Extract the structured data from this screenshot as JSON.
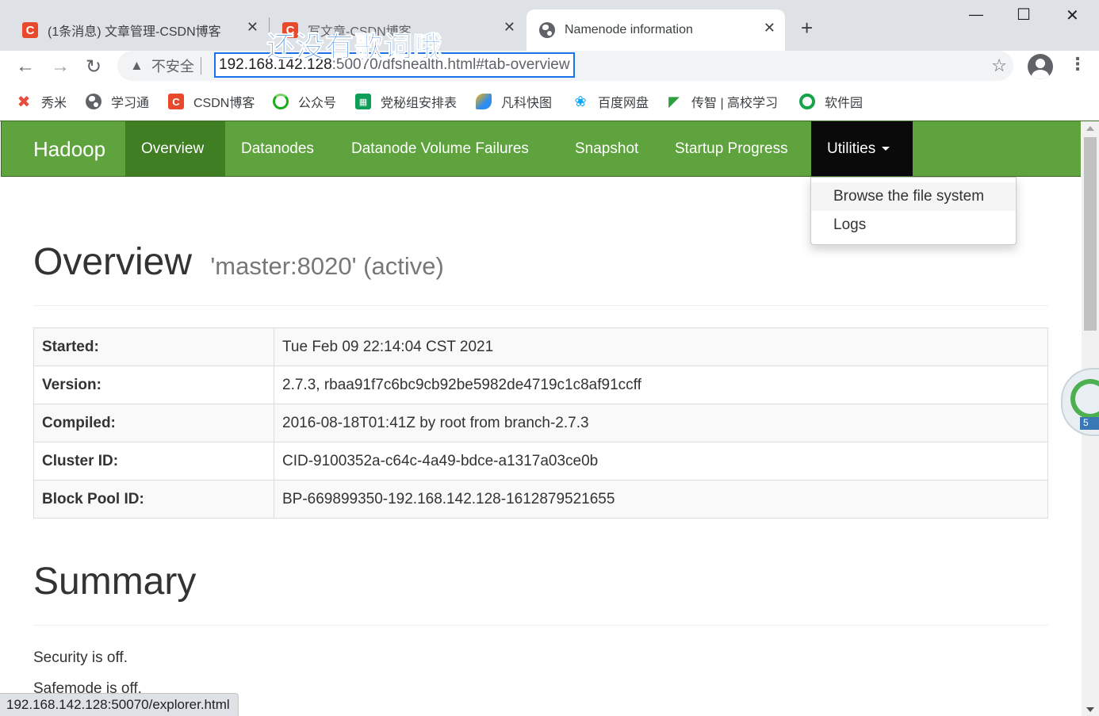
{
  "browser": {
    "tabs": [
      {
        "title": "(1条消息) 文章管理-CSDN博客",
        "icon": "csdn-icon",
        "active": false
      },
      {
        "title": "写文章-CSDN博客",
        "icon": "csdn-icon",
        "active": false
      },
      {
        "title": "Namenode information",
        "icon": "globe-icon",
        "active": true
      }
    ],
    "favicon_letter": "C",
    "new_tab": "+",
    "window_controls": {
      "minimize": "—",
      "maximize": "☐",
      "close": "✕"
    },
    "overlay_text": "还没有歌词哦",
    "security_label": "不安全",
    "url_host": "192.168.142.128",
    "url_rest": ":50070/dfshealth.html#tab-overview",
    "bookmarks": [
      {
        "label": "秀米",
        "icon": "xiumi-icon",
        "color": "#e94b3c"
      },
      {
        "label": "学习通",
        "icon": "globe-icon",
        "color": "#5f6368"
      },
      {
        "label": "CSDN博客",
        "icon": "csdn-icon",
        "color": "#e8492c"
      },
      {
        "label": "公众号",
        "icon": "wechat-mp-icon",
        "color": "#1aad19"
      },
      {
        "label": "党秘组安排表",
        "icon": "sheet-icon",
        "color": "#0f9d58"
      },
      {
        "label": "凡科快图",
        "icon": "fanke-icon",
        "color": "#2d8cf0"
      },
      {
        "label": "百度网盘",
        "icon": "baidu-pan-icon",
        "color": "#06a7ff"
      },
      {
        "label": "传智 | 高校学习",
        "icon": "chuanzhi-icon",
        "color": "#2e9e3f"
      },
      {
        "label": "软件园",
        "icon": "software-park-icon",
        "color": "#16a34a"
      }
    ]
  },
  "navbar": {
    "brand": "Hadoop",
    "items": [
      {
        "label": "Overview",
        "active": true
      },
      {
        "label": "Datanodes"
      },
      {
        "label": "Datanode Volume Failures"
      },
      {
        "label": "Snapshot"
      },
      {
        "label": "Startup Progress"
      },
      {
        "label": "Utilities",
        "open": true
      }
    ],
    "colors": {
      "bar": "#5fa33e",
      "active": "#3f7e23",
      "open": "#0a0a0a"
    }
  },
  "dropdown": {
    "items": [
      "Browse the file system",
      "Logs"
    ]
  },
  "overview": {
    "title": "Overview",
    "subtitle": "'master:8020' (active)",
    "rows": [
      {
        "label": "Started:",
        "value": "Tue Feb 09 22:14:04 CST 2021"
      },
      {
        "label": "Version:",
        "value": "2.7.3, rbaa91f7c6bc9cb92be5982de4719c1c8af91ccff"
      },
      {
        "label": "Compiled:",
        "value": "2016-08-18T01:41Z by root from branch-2.7.3"
      },
      {
        "label": "Cluster ID:",
        "value": "CID-9100352a-c64c-4a49-bdce-a1317a03ce0b"
      },
      {
        "label": "Block Pool ID:",
        "value": "BP-669899350-192.168.142.128-1612879521655"
      }
    ]
  },
  "summary": {
    "title": "Summary",
    "security": "Security is off.",
    "safemode": "Safemode is off."
  },
  "gadget_label": "5",
  "status_url": "192.168.142.128:50070/explorer.html"
}
